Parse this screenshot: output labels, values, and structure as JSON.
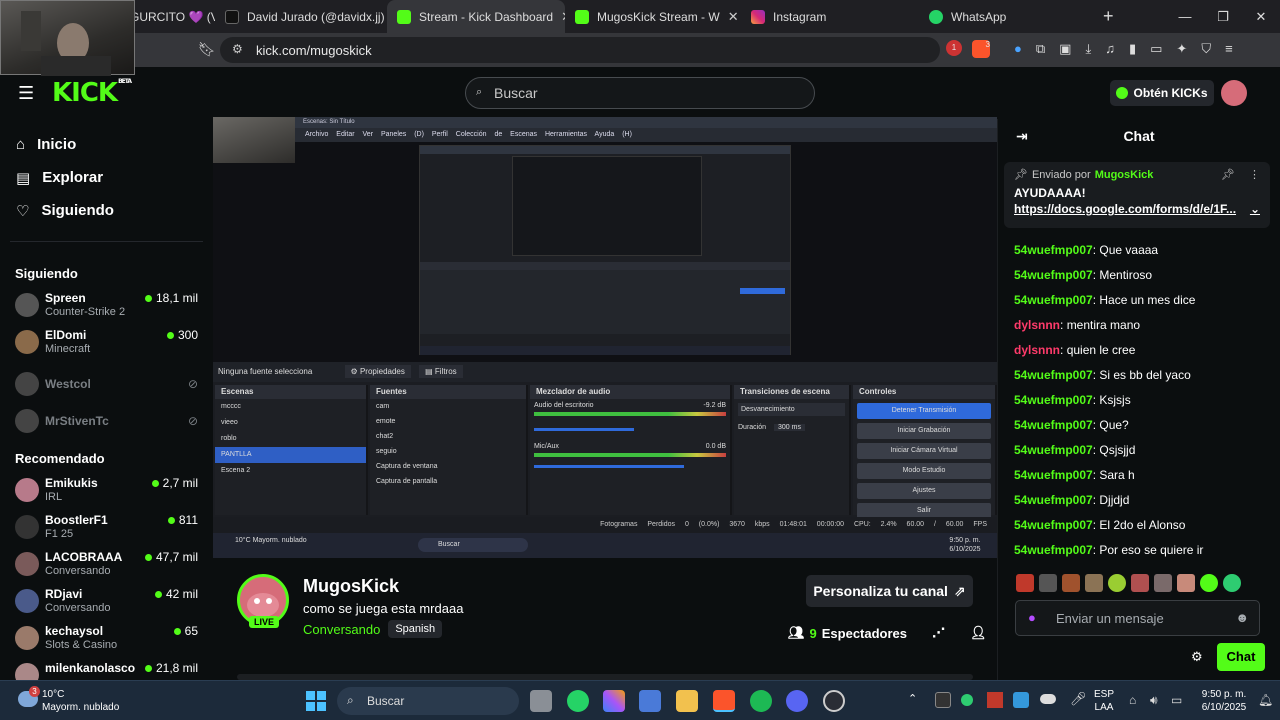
{
  "browser": {
    "tabs": [
      {
        "label": "GURCITO 💜 (V",
        "active": false
      },
      {
        "label": "David Jurado (@davidx.jj) | TikT",
        "active": false
      },
      {
        "label": "Stream - Kick Dashboard",
        "active": true
      },
      {
        "label": "MugosKick Stream - W",
        "active": false
      },
      {
        "label": "Instagram",
        "active": false
      },
      {
        "label": "WhatsApp",
        "active": false
      }
    ],
    "url": "kick.com/mugoskick",
    "shields_count": "3",
    "alert_count": "1"
  },
  "header": {
    "logo": "KICK",
    "logo_badge": "BETA",
    "search_placeholder": "Buscar",
    "get_kicks_label": "Obtén KICKs"
  },
  "sidebar": {
    "nav": [
      {
        "label": "Inicio",
        "icon": "home-icon"
      },
      {
        "label": "Explorar",
        "icon": "compass-icon"
      },
      {
        "label": "Siguiendo",
        "icon": "heart-icon"
      }
    ],
    "following_title": "Siguiendo",
    "following": [
      {
        "name": "Spreen",
        "game": "Counter-Strike 2",
        "viewers": "18,1 mil",
        "online": true,
        "color": "#555"
      },
      {
        "name": "ElDomi",
        "game": "Minecraft",
        "viewers": "300",
        "online": true,
        "color": "#8a6a4a"
      },
      {
        "name": "Westcol",
        "game": "",
        "viewers": "",
        "online": false,
        "color": "#444"
      },
      {
        "name": "MrStivenTc",
        "game": "",
        "viewers": "",
        "online": false,
        "color": "#444"
      }
    ],
    "recommended_title": "Recomendado",
    "recommended": [
      {
        "name": "Emikukis",
        "game": "IRL",
        "viewers": "2,7 mil",
        "color": "#b77a8a"
      },
      {
        "name": "BoostlerF1",
        "game": "F1 25",
        "viewers": "811",
        "color": "#333"
      },
      {
        "name": "LACOBRAAA",
        "game": "Conversando",
        "viewers": "47,7 mil",
        "color": "#7a5a5a"
      },
      {
        "name": "RDjavi",
        "game": "Conversando",
        "viewers": "42 mil",
        "color": "#4a5a8a"
      },
      {
        "name": "kechaysol",
        "game": "Slots & Casino",
        "viewers": "65",
        "color": "#9a7a6a"
      },
      {
        "name": "milenkanolasco",
        "game": "",
        "viewers": "21,8 mil",
        "color": "#aa8888"
      }
    ]
  },
  "player": {
    "obs_title": "Escenas: Sin Título",
    "obs_menu": "Archivo  Editar  Ver  Paneles (D)  Perfil  Colección de Escenas  Herramientas  Ayuda (H)",
    "no_source": "Ninguna fuente selecciona",
    "props": "Propiedades",
    "filters": "Filtros",
    "scenes_title": "Escenas",
    "scenes": [
      "mcccc",
      "vieeo",
      "roblo",
      "PANTLLA",
      "Escena 2"
    ],
    "selected_scene": "PANTLLA",
    "sources_title": "Fuentes",
    "sources": [
      "cam",
      "emote",
      "chat2",
      "seguio",
      "Captura de ventana",
      "Captura de pantalla"
    ],
    "mixer_title": "Mezclador de audio",
    "mixer_tracks": [
      {
        "name": "Audio del escritorio",
        "db": "-9.2 dB"
      },
      {
        "name": "Mic/Aux",
        "db": "0.0 dB"
      }
    ],
    "transitions_title": "Transiciones de escena",
    "transition": "Desvanecimiento",
    "duration_label": "Duración",
    "duration": "300 ms",
    "controls_title": "Controles",
    "controls": [
      "Detener Transmisión",
      "Iniciar Grabación",
      "Iniciar Cámara Virtual",
      "Modo Estudio",
      "Ajustes",
      "Salir"
    ],
    "status": "Fotogramas Perdidos 0 (0.0%)   3670 kbps   01:48:01   00:00:00   CPU: 2.4%   60.00 / 60.00 FPS",
    "inner_weather": "10°C Mayorm. nublado",
    "inner_search": "Buscar",
    "inner_time": "9:50 p. m. 6/10/2025"
  },
  "stream_info": {
    "channel": "MugosKick",
    "title": "como se juega esta mrdaaa",
    "category": "Conversando",
    "tag": "Spanish",
    "live_badge": "LIVE",
    "customize_label": "Personaliza tu canal",
    "viewers_count": "9",
    "viewers_label": "Espectadores"
  },
  "chat": {
    "title": "Chat",
    "pinned_by_label": "Enviado por",
    "pinned_by": "MugosKick",
    "pinned_message": "AYUDAAAA!",
    "pinned_link": "https://docs.google.com/forms/d/e/1F...",
    "messages": [
      {
        "user": "54wuefmp007",
        "text": "Que vaaaa",
        "color": "green"
      },
      {
        "user": "54wuefmp007",
        "text": "Mentiroso",
        "color": "green"
      },
      {
        "user": "54wuefmp007",
        "text": "Hace un mes dice",
        "color": "green"
      },
      {
        "user": "dylsnnn",
        "text": "mentira mano",
        "color": "red"
      },
      {
        "user": "dylsnnn",
        "text": "quien le cree",
        "color": "red"
      },
      {
        "user": "54wuefmp007",
        "text": "Si es bb del yaco",
        "color": "green"
      },
      {
        "user": "54wuefmp007",
        "text": "Ksjsjs",
        "color": "green"
      },
      {
        "user": "54wuefmp007",
        "text": "Que?",
        "color": "green"
      },
      {
        "user": "54wuefmp007",
        "text": "Qsjsjjd",
        "color": "green"
      },
      {
        "user": "54wuefmp007",
        "text": "Sara h",
        "color": "green"
      },
      {
        "user": "54wuefmp007",
        "text": "Djjdjd",
        "color": "green"
      },
      {
        "user": "54wuefmp007",
        "text": "El 2do el Alonso",
        "color": "green"
      },
      {
        "user": "54wuefmp007",
        "text": "Por eso se quiere ir",
        "color": "green"
      }
    ],
    "input_placeholder": "Enviar un mensaje",
    "send_label": "Chat"
  },
  "taskbar": {
    "weather_temp": "10°C",
    "weather_desc": "Mayorm. nublado",
    "weather_badge": "3",
    "search_placeholder": "Buscar",
    "lang": "ESP",
    "lang_sub": "LAA",
    "time": "9:50 p. m.",
    "date": "6/10/2025"
  }
}
